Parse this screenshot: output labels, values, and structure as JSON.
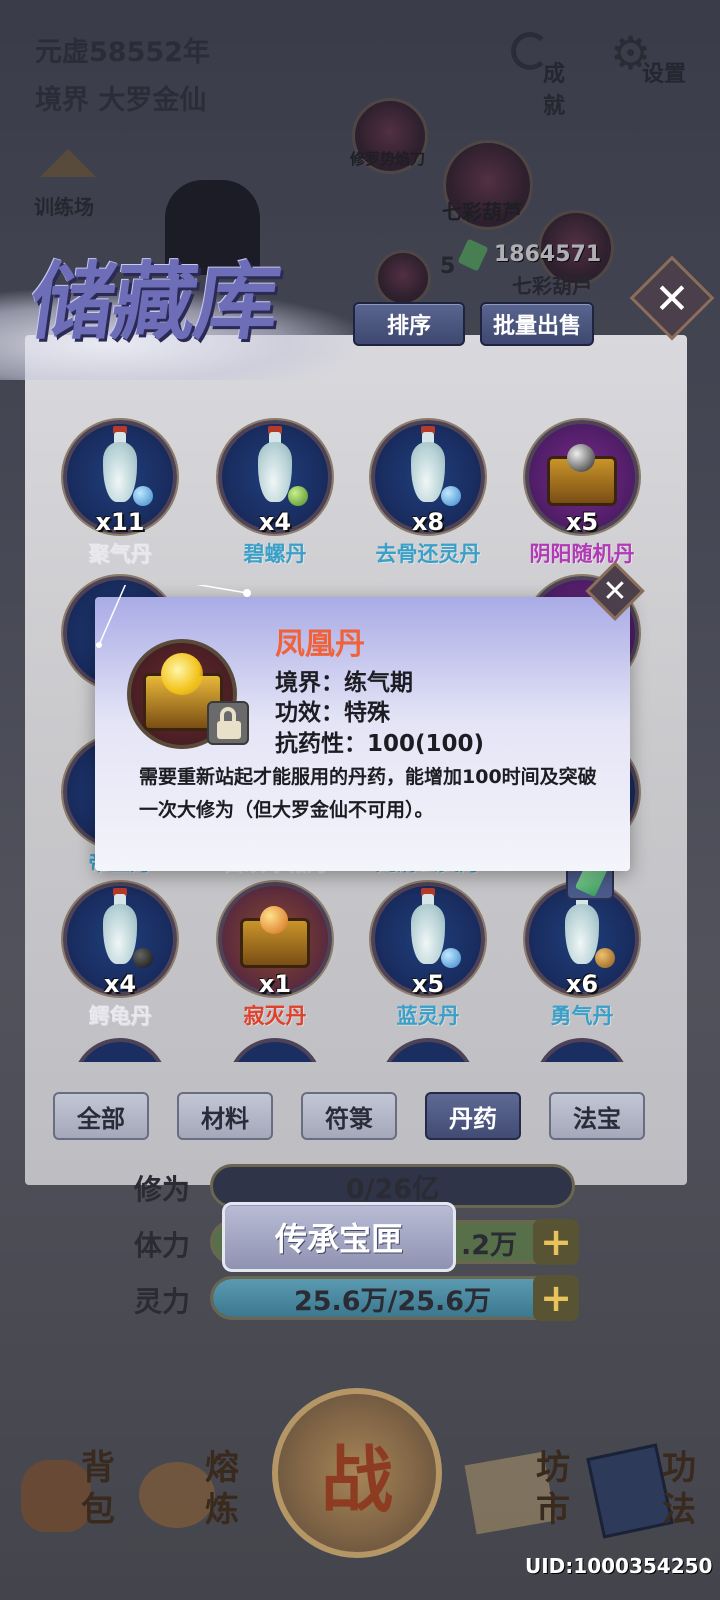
{
  "hud": {
    "era": "元虚58552年",
    "realm": "境界 大罗金仙",
    "achievements": "成就",
    "settings": "设置",
    "training": "训练场",
    "map_nodes": [
      "修罗势焰刀",
      "七彩葫芦",
      "七彩葫芦"
    ],
    "map_count": "5",
    "gems": "1864571"
  },
  "storage": {
    "title": "储藏库",
    "sort_label": "排序",
    "bulk_sell_label": "批量出售",
    "close": "✕",
    "items": [
      {
        "name": "聚气丹",
        "count": "x11",
        "color": "#e8e8ee"
      },
      {
        "name": "碧螺丹",
        "count": "x4",
        "color": "#3aa0c8"
      },
      {
        "name": "去骨还灵丹",
        "count": "x8",
        "color": "#3aa0c8"
      },
      {
        "name": "阴阳随机丹",
        "count": "x5",
        "color": "#b03bb5"
      },
      {
        "name": "鳄龟丹",
        "count": "x4",
        "color": "#e8e8ee"
      },
      {
        "name": "寂灭丹",
        "count": "x1",
        "color": "#e0402a"
      },
      {
        "name": "蓝灵丹",
        "count": "x5",
        "color": "#3aa0c8"
      },
      {
        "name": "勇气丹",
        "count": "x6",
        "color": "#3aa0c8"
      }
    ],
    "partial_names": [
      "帝王丹",
      "白纹冰霜丹",
      "九清玄灵丹"
    ],
    "tabs": [
      "全部",
      "材料",
      "符箓",
      "丹药",
      "法宝"
    ],
    "active_tab": "丹药"
  },
  "tooltip": {
    "name": "凤凰丹",
    "realm": "境界：练气期",
    "effect": "功效：特殊",
    "resistance": "抗药性：100(100)",
    "description": "需要重新站起才能服用的丹药，能增加100时间及突破一次大修为（但大罗金仙不可用）。",
    "close": "✕"
  },
  "stats": {
    "cultivation_label": "修为",
    "cultivation_value": "0/26亿",
    "stamina_label": "体力",
    "stamina_value": ".2万",
    "spirit_label": "灵力",
    "spirit_value": "25.6万/25.6万",
    "plus": "+",
    "legacy_button": "传承宝匣"
  },
  "bottom_nav": {
    "bag": [
      "背",
      "包"
    ],
    "smelt": [
      "熔",
      "炼"
    ],
    "battle": "战",
    "market": [
      "坊",
      "市"
    ],
    "skills": [
      "功",
      "法"
    ]
  },
  "uid": "UID:1000354250"
}
